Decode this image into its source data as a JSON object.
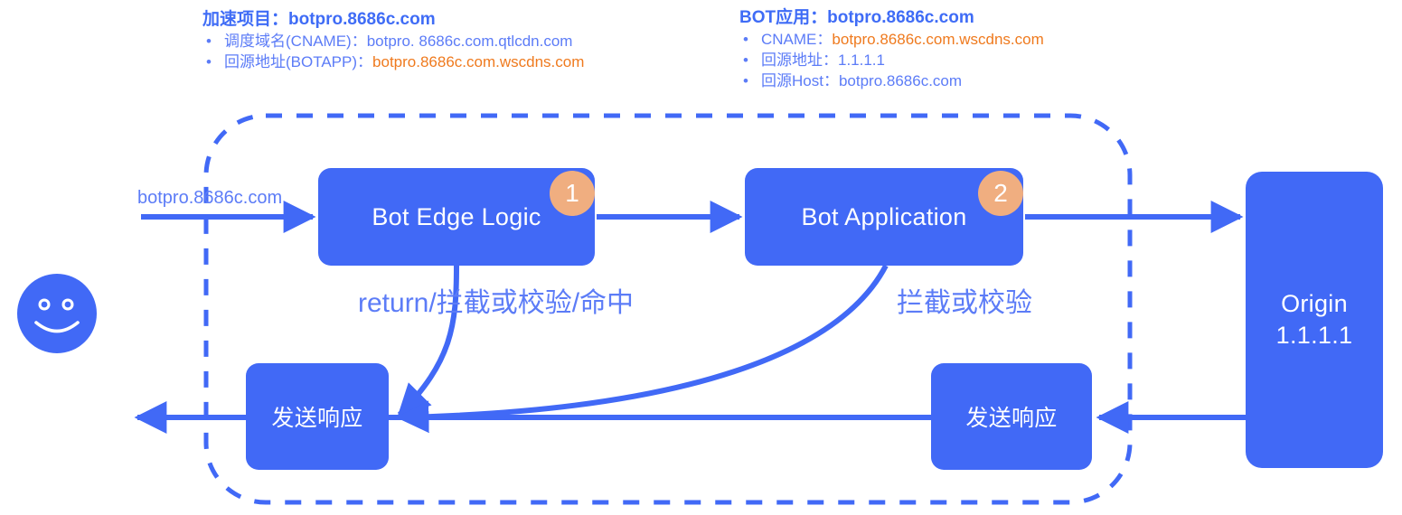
{
  "annotations": {
    "left": {
      "title": "加速项目：botpro.8686c.com",
      "items": [
        {
          "label": "调度域名(CNAME)：",
          "value": "botpro. 8686c.com.qtlcdn.com",
          "value_color": "#5C7CF7"
        },
        {
          "label": "回源地址(BOTAPP)：",
          "value": "botpro.8686c.com.wscdns.com",
          "value_color": "#EF7A1E"
        }
      ]
    },
    "right": {
      "title": "BOT应用：botpro.8686c.com",
      "items": [
        {
          "label": "CNAME：",
          "value": "botpro.8686c.com.wscdns.com",
          "value_color": "#EF7A1E"
        },
        {
          "label": "回源地址：",
          "value": "1.1.1.1",
          "value_color": "#5C7CF7"
        },
        {
          "label": "回源Host：",
          "value": "botpro.8686c.com",
          "value_color": "#5C7CF7"
        }
      ]
    }
  },
  "nodes": {
    "edge_logic": "Bot Edge Logic",
    "bot_application": "Bot Application",
    "origin_title": "Origin",
    "origin_ip": "1.1.1.1",
    "response_left": "发送响应",
    "response_right": "发送响应"
  },
  "badges": {
    "one": "1",
    "two": "2"
  },
  "labels": {
    "request_domain": "botpro.8686c.com",
    "return_path": "return/拦截或校验/命中",
    "intercept_path": "拦截或校验"
  },
  "icons": {
    "user": "smiley-face-icon"
  },
  "colors": {
    "primary_blue": "#4169F6",
    "text_blue": "#5C7CF7",
    "title_blue": "#3F6CF6",
    "accent_orange": "#EF7A1E",
    "badge_peach": "#F0AE80",
    "background": "#FFFFFF"
  }
}
